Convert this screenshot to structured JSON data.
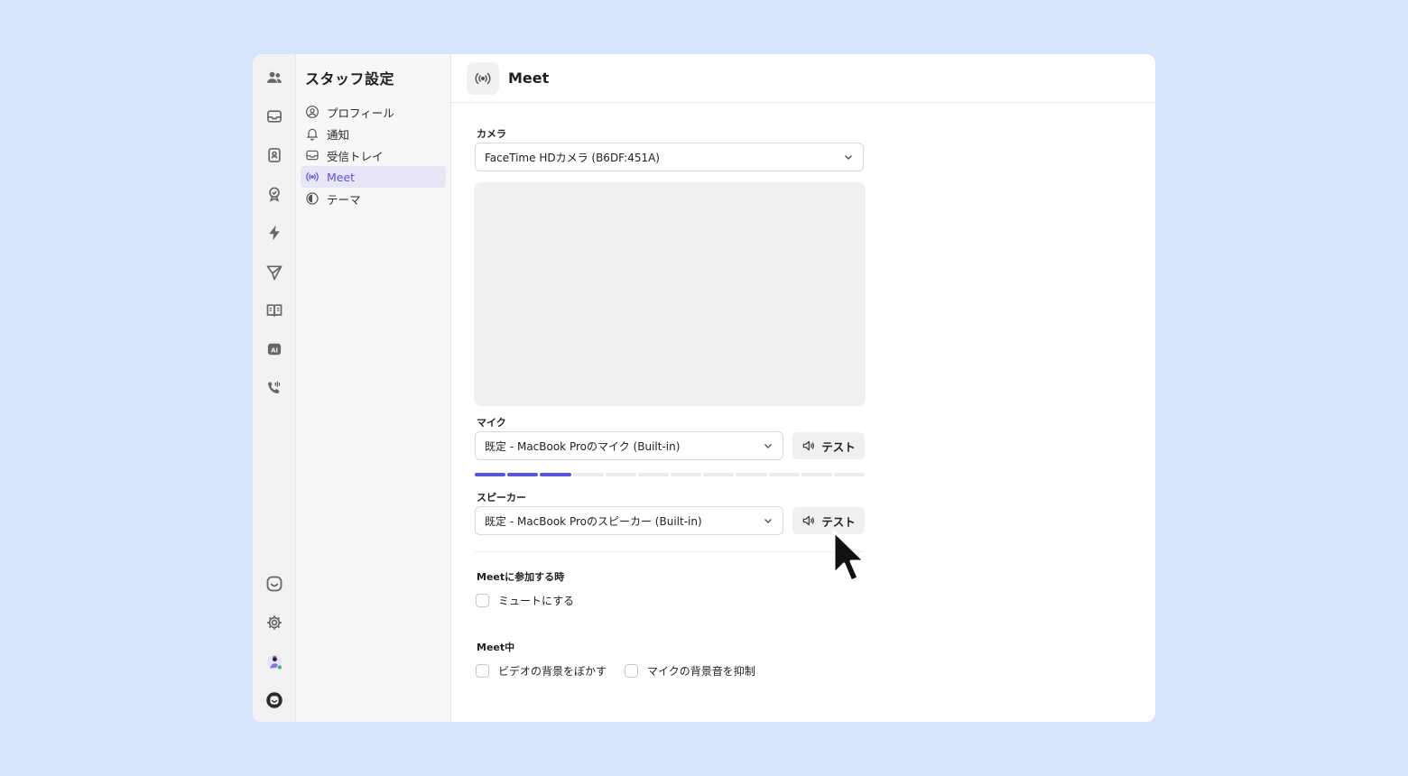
{
  "settings": {
    "title": "スタッフ設定",
    "items": [
      {
        "label": "プロフィール",
        "icon": "user-circle-icon"
      },
      {
        "label": "通知",
        "icon": "bell-icon"
      },
      {
        "label": "受信トレイ",
        "icon": "inbox-icon"
      },
      {
        "label": "Meet",
        "icon": "broadcast-icon",
        "active": true
      },
      {
        "label": "テーマ",
        "icon": "theme-icon"
      }
    ]
  },
  "rail": {
    "icons": [
      "team-icon",
      "inbox-icon",
      "contacts-icon",
      "badge-icon",
      "bolt-icon",
      "send-icon",
      "book-icon",
      "ai-icon",
      "phone-icon",
      "chat-icon",
      "gear-icon",
      "avatar",
      "brand-icon"
    ]
  },
  "header": {
    "title": "Meet",
    "icon": "broadcast-icon"
  },
  "camera": {
    "label": "カメラ",
    "selected": "FaceTime HDカメラ (B6DF:451A)"
  },
  "mic": {
    "label": "マイク",
    "selected": "既定 - MacBook Proのマイク (Built-in)",
    "test_label": "テスト",
    "level_segments_total": 12,
    "level_segments_active": 3
  },
  "speaker": {
    "label": "スピーカー",
    "selected": "既定 - MacBook Proのスピーカー (Built-in)",
    "test_label": "テスト"
  },
  "join": {
    "label": "Meetに参加する時",
    "mute_label": "ミュートにする"
  },
  "during": {
    "label": "Meet中",
    "blur_label": "ビデオの背景をぼかす",
    "noise_label": "マイクの背景音を抑制"
  },
  "colors": {
    "accent": "#5b54d6",
    "background": "#d6e4fc",
    "active_nav_bg": "#e7e5f6"
  }
}
